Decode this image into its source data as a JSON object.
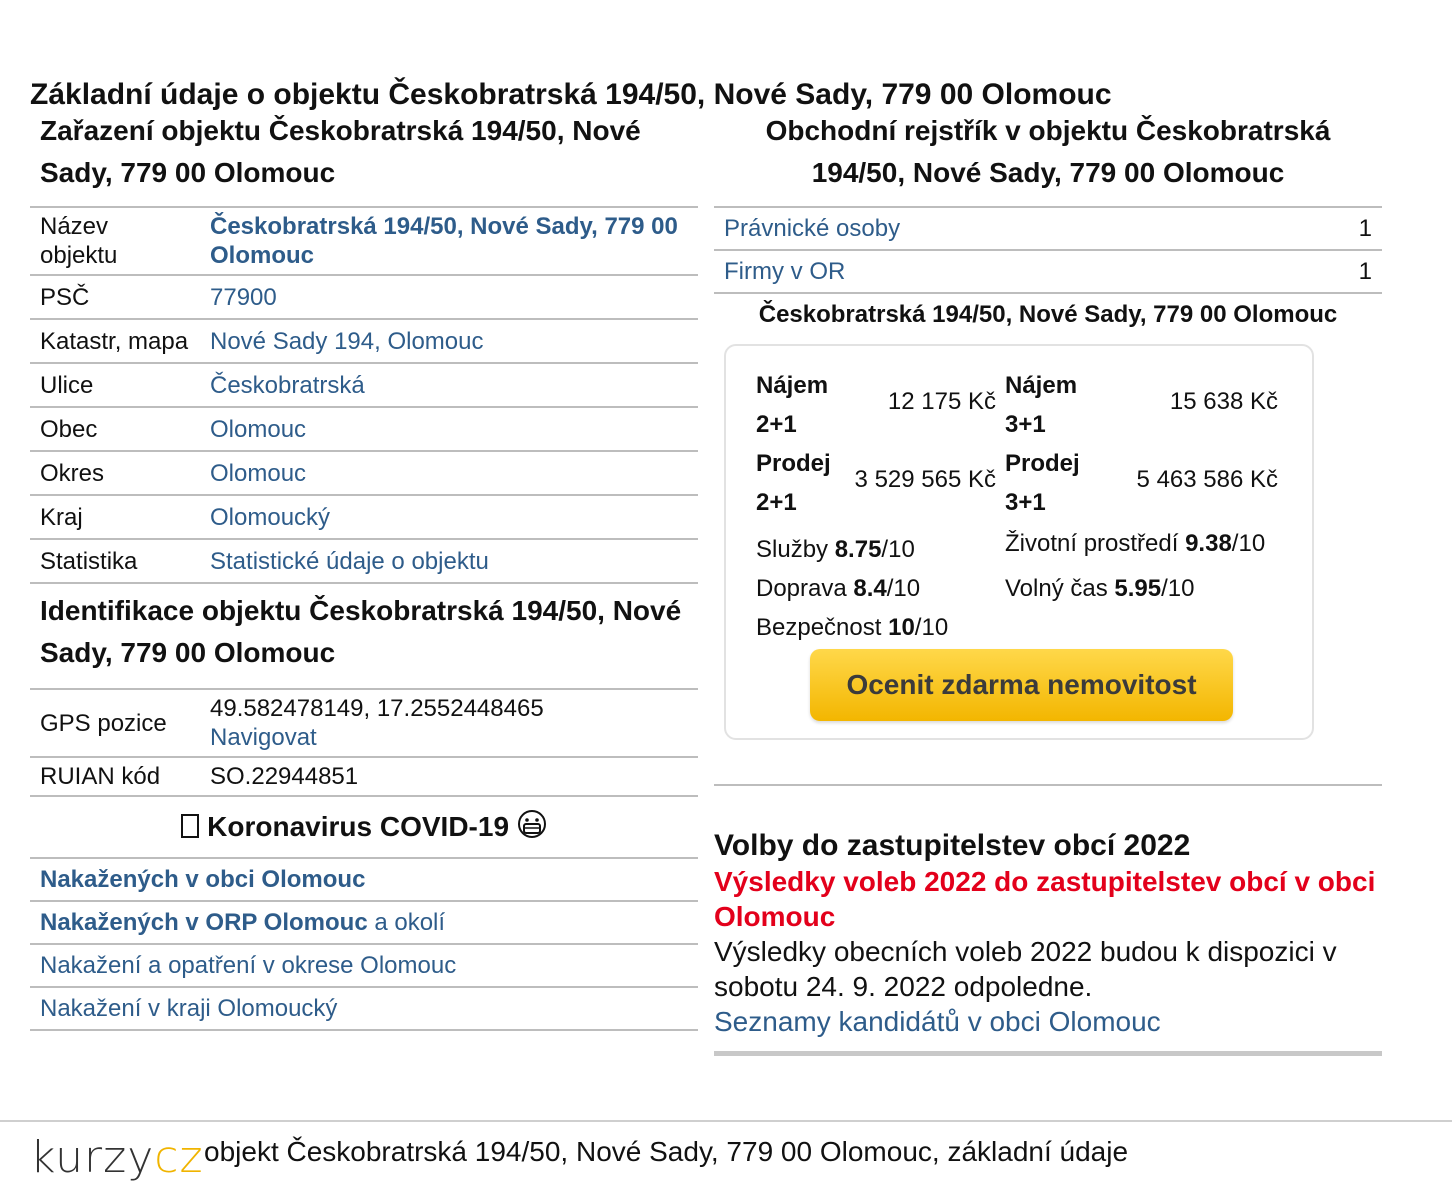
{
  "main_title": "Základní údaje o objektu Českobratrská 194/50, Nové Sady, 779 00 Olomouc",
  "classification": {
    "title": "Zařazení objektu Českobratrská 194/50, Nové Sady, 779 00 Olomouc",
    "rows": [
      {
        "key": "Název objektu",
        "value": "Českobratrská 194/50, Nové Sady, 779 00 Olomouc"
      },
      {
        "key": "PSČ",
        "value": "77900"
      },
      {
        "key": "Katastr, mapa",
        "value": "Nové Sady 194, Olomouc"
      },
      {
        "key": "Ulice",
        "value": "Českobratrská"
      },
      {
        "key": "Obec",
        "value": "Olomouc"
      },
      {
        "key": "Okres",
        "value": "Olomouc"
      },
      {
        "key": "Kraj",
        "value": "Olomoucký"
      },
      {
        "key": "Statistika",
        "value": "Statistické údaje o objektu"
      }
    ]
  },
  "identification": {
    "title": "Identifikace objektu Českobratrská 194/50, Nové Sady, 779 00 Olomouc",
    "gps_label": "GPS pozice",
    "gps_value": "49.582478149, 17.2552448465",
    "navigate": "Navigovat",
    "ruian_label": "RUIAN kód",
    "ruian_value": "SO.22944851"
  },
  "covid": {
    "title": "Koronavirus COVID-19",
    "icon_left": "square-placeholder-icon",
    "icon_right": "mask-face-icon",
    "row1_link": "Nakažených v obci Olomouc",
    "row2_link": "Nakažených v ORP Olomouc",
    "row2_suffix": " a okolí",
    "row3_link": "Nakažení a opatření v okrese Olomouc",
    "row4_link": "Nakažení v kraji Olomoucký"
  },
  "business": {
    "title": "Obchodní rejstřík v objektu Českobratrská 194/50, Nové Sady, 779 00 Olomouc",
    "rows": [
      {
        "label": "Právnické osoby",
        "count": "1"
      },
      {
        "label": "Firmy v OR",
        "count": "1"
      }
    ],
    "address": "Českobratrská 194/50, Nové Sady, 779 00 Olomouc"
  },
  "prices": {
    "rent21_label": "Nájem 2+1",
    "rent21_value": "12 175 Kč",
    "rent31_label": "Nájem 3+1",
    "rent31_value": "15 638 Kč",
    "sale21_label": "Prodej 2+1",
    "sale21_value": "3 529 565 Kč",
    "sale31_label": "Prodej 3+1",
    "sale31_value": "5 463 586 Kč"
  },
  "ratings": {
    "services_label": "Služby ",
    "services_value": "8.75",
    "services_max": "/10",
    "env_label": "Životní prostředí ",
    "env_value": "9.38",
    "env_max": "/10",
    "transport_label": "Doprava ",
    "transport_value": "8.4",
    "transport_max": "/10",
    "leisure_label": "Volný čas ",
    "leisure_value": "5.95",
    "leisure_max": "/10",
    "safety_label": "Bezpečnost ",
    "safety_value": "10",
    "safety_max": "/10"
  },
  "cta_label": "Ocenit zdarma nemovitost",
  "elections": {
    "title": "Volby do zastupitelstev obcí 2022",
    "results_link": "Výsledky voleb 2022 do zastupitelstev obcí v obci Olomouc",
    "text": "Výsledky obecních voleb 2022 budou k dispozici v sobotu 24. 9. 2022 odpoledne.",
    "candidates_link": "Seznamy kandidátů v obci Olomouc"
  },
  "footer": {
    "logo_part1": "kurzy",
    "logo_part2": "cz",
    "text": "objekt Českobratrská 194/50, Nové Sady, 779 00 Olomouc, základní údaje"
  },
  "colors": {
    "link": "#2e5c8a",
    "elections_red": "#e3001b",
    "cta_yellow": "#f3b600",
    "logo_yellow": "#f0b400"
  }
}
